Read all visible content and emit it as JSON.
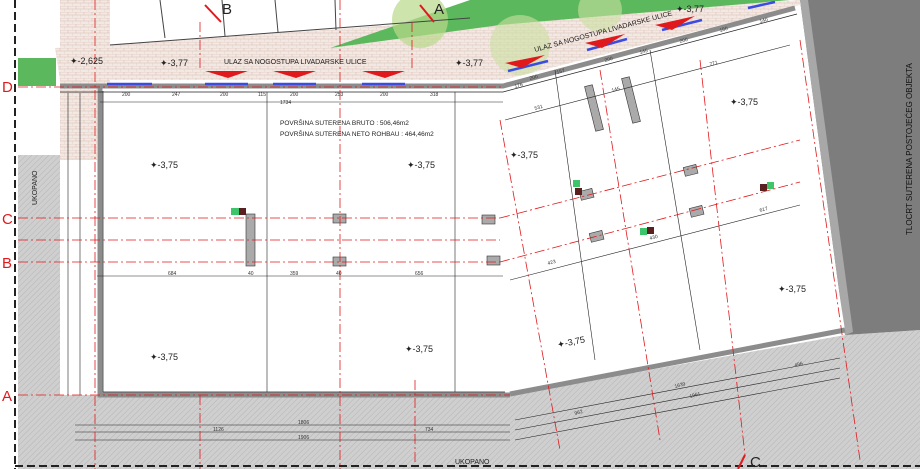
{
  "drawing": {
    "grid_axes": [
      "D",
      "C",
      "B",
      "A"
    ],
    "section_marks": {
      "top_left": "B",
      "top_right": "A",
      "bottom": "C"
    },
    "area_bruto": "POVRŠINA SUTERENA BRUTO : 506,46m2",
    "area_neto": "POVRŠINA SUTERENA NETO ROHBAU : 464,46m2",
    "entrance_label": "ULAZ SA NOGOSTUPA LIVADARSKE ULICE",
    "excavated_label": "UKOPANO",
    "existing_building_label": "TLOCRT SUTERENA POSTOJEĆEG OBJEKTA",
    "elevations": {
      "floor": "-3,75",
      "sidewalk": "-3,77",
      "stair": "-2,625"
    },
    "dims_top": [
      "200",
      "247",
      "200",
      "115",
      "200",
      "253",
      "200",
      "318"
    ],
    "dims_top_total": "1734",
    "dims_mid": [
      "684",
      "40",
      "359",
      "40",
      "656"
    ],
    "dims_bottom": {
      "overall": "1806",
      "left": "1126",
      "right": "734",
      "total": "1906"
    },
    "dims_right_top": [
      "176",
      "200",
      "157",
      "200",
      "145",
      "200",
      "180",
      "140"
    ],
    "dims_right_misc": [
      "531",
      "145",
      "771",
      "423",
      "430",
      "617",
      "1639",
      "1961",
      "962",
      "496"
    ],
    "colors": {
      "axis": "#e0191c",
      "wall": "#9a9a9a",
      "window": "#3b4de0",
      "grass": "#4caf50",
      "soil": "#c8c8c8",
      "existing": "#7d7d7d"
    }
  }
}
